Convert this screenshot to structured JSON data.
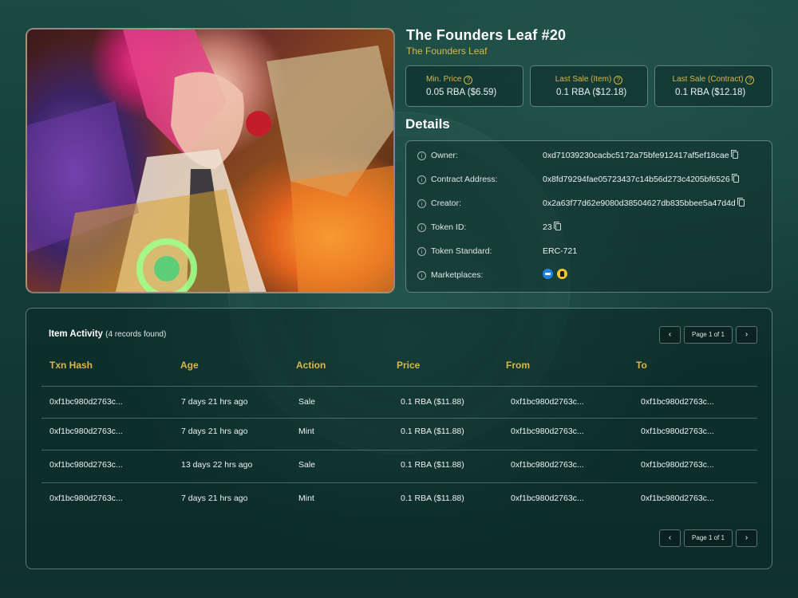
{
  "item": {
    "title": "The Founders Leaf #20",
    "collection": "The Founders Leaf"
  },
  "stats": [
    {
      "label": "Min. Price",
      "value": "0.05 RBA ($6.59)"
    },
    {
      "label": "Last Sale (Item)",
      "value": "0.1 RBA ($12.18)"
    },
    {
      "label": "Last Sale (Contract)",
      "value": "0.1 RBA ($12.18)"
    }
  ],
  "details": {
    "heading": "Details",
    "rows": [
      {
        "label": "Owner:",
        "value": "0xd71039230cacbc5172a75bfe912417af5ef18cae"
      },
      {
        "label": "Contract Address:",
        "value": "0x8fd79294fae05723437c14b56d273c4205bf6526"
      },
      {
        "label": "Creator:",
        "value": "0x2a63f77d62e9080d38504627db835bbee5a47d4d"
      },
      {
        "label": "Token ID:",
        "value": "23"
      },
      {
        "label": "Token Standard:",
        "value": "ERC-721"
      },
      {
        "label": "Marketplaces:",
        "value": ""
      }
    ],
    "marketplace_icons": [
      "opensea-icon",
      "marketplace-icon"
    ]
  },
  "activity": {
    "title": "Item Activity",
    "count_text": "(4 records found)",
    "pager": {
      "prev": "‹",
      "label": "Page 1 of 1",
      "next": "›"
    },
    "columns": [
      "Txn Hash",
      "Age",
      "Action",
      "Price",
      "From",
      "To"
    ],
    "rows": [
      [
        "0xf1bc980d2763c...",
        "7 days 21 hrs ago",
        "Sale",
        "0.1 RBA ($11.88)",
        "0xf1bc980d2763c...",
        "0xf1bc980d2763c..."
      ],
      [
        "0xf1bc980d2763c...",
        "7 days 21 hrs ago",
        "Mint",
        "0.1 RBA ($11.88)",
        "0xf1bc980d2763c...",
        "0xf1bc980d2763c..."
      ],
      [
        "0xf1bc980d2763c...",
        "13 days 22 hrs ago",
        "Sale",
        "0.1 RBA ($11.88)",
        "0xf1bc980d2763c...",
        "0xf1bc980d2763c..."
      ],
      [
        "0xf1bc980d2763c...",
        "7 days 21 hrs ago",
        "Mint",
        "0.1 RBA ($11.88)",
        "0xf1bc980d2763c...",
        "0xf1bc980d2763c..."
      ]
    ]
  },
  "colors": {
    "accent_gold": "#d8b84a",
    "background": "#143c37",
    "panel_border": "#aac8be"
  }
}
